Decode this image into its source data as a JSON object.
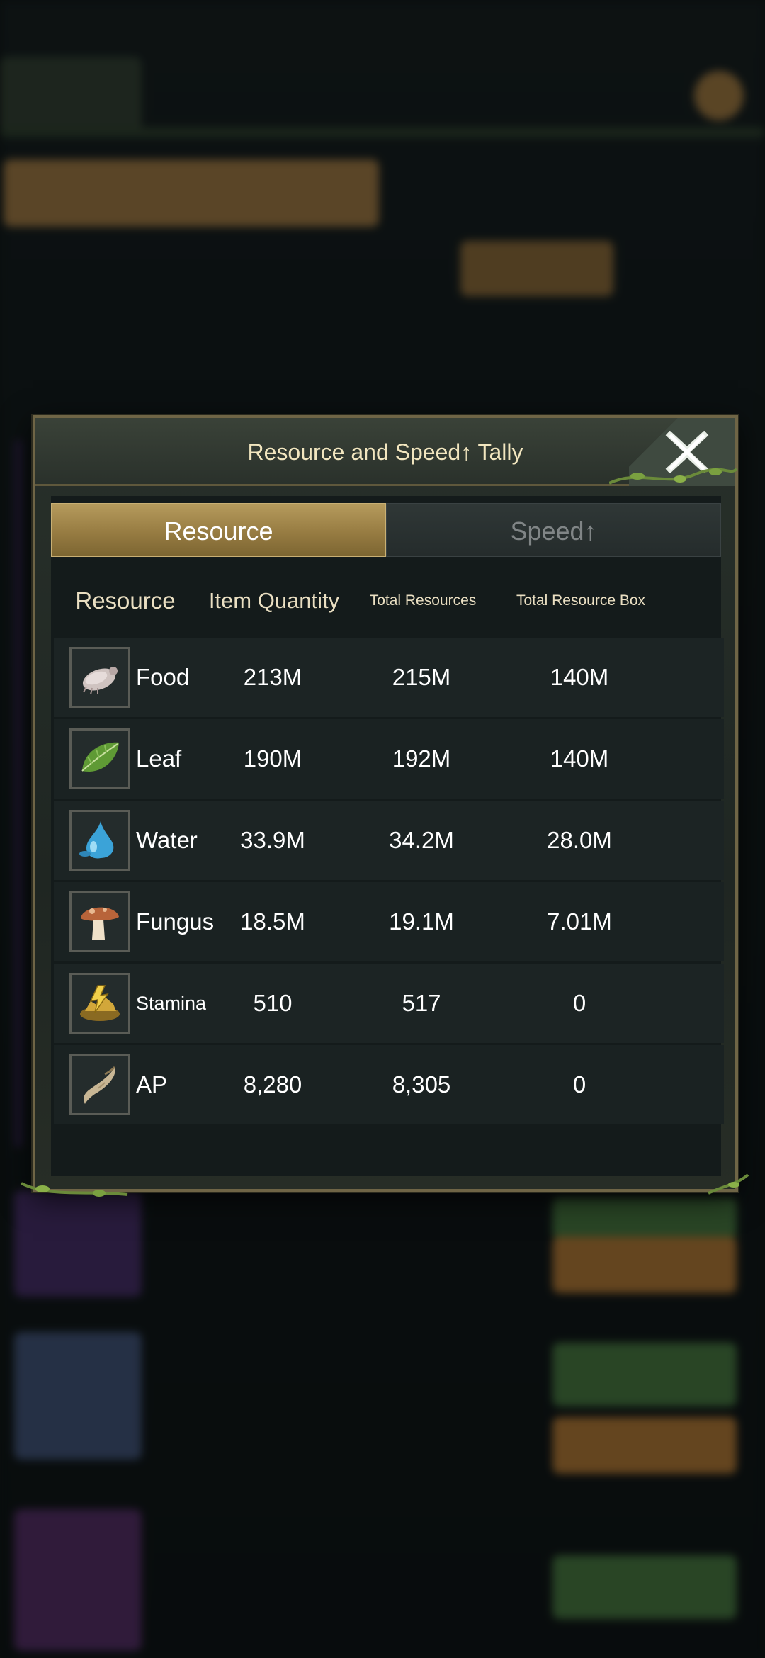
{
  "dialog": {
    "title": "Resource and Speed↑ Tally",
    "close_icon": "close-x-icon"
  },
  "tabs": [
    {
      "label": "Resource",
      "active": true
    },
    {
      "label": "Speed↑",
      "active": false
    }
  ],
  "table": {
    "headers": {
      "resource": "Resource",
      "item_quantity": "Item Quantity",
      "total_resources": "Total Resources",
      "total_resource_box": "Total Resource Box"
    },
    "rows": [
      {
        "icon": "food-icon",
        "name": "Food",
        "item_quantity": "213M",
        "total_resources": "215M",
        "total_resource_box": "140M"
      },
      {
        "icon": "leaf-icon",
        "name": "Leaf",
        "item_quantity": "190M",
        "total_resources": "192M",
        "total_resource_box": "140M"
      },
      {
        "icon": "water-icon",
        "name": "Water",
        "item_quantity": "33.9M",
        "total_resources": "34.2M",
        "total_resource_box": "28.0M"
      },
      {
        "icon": "fungus-icon",
        "name": "Fungus",
        "item_quantity": "18.5M",
        "total_resources": "19.1M",
        "total_resource_box": "7.01M"
      },
      {
        "icon": "stamina-icon",
        "name": "Stamina",
        "item_quantity": "510",
        "total_resources": "517",
        "total_resource_box": "0"
      },
      {
        "icon": "ap-horn-icon",
        "name": "AP",
        "item_quantity": "8,280",
        "total_resources": "8,305",
        "total_resource_box": "0"
      }
    ]
  },
  "colors": {
    "tab_active": "#a88c4e",
    "title_text": "#f2e6bf",
    "frame": "#6f6546"
  }
}
